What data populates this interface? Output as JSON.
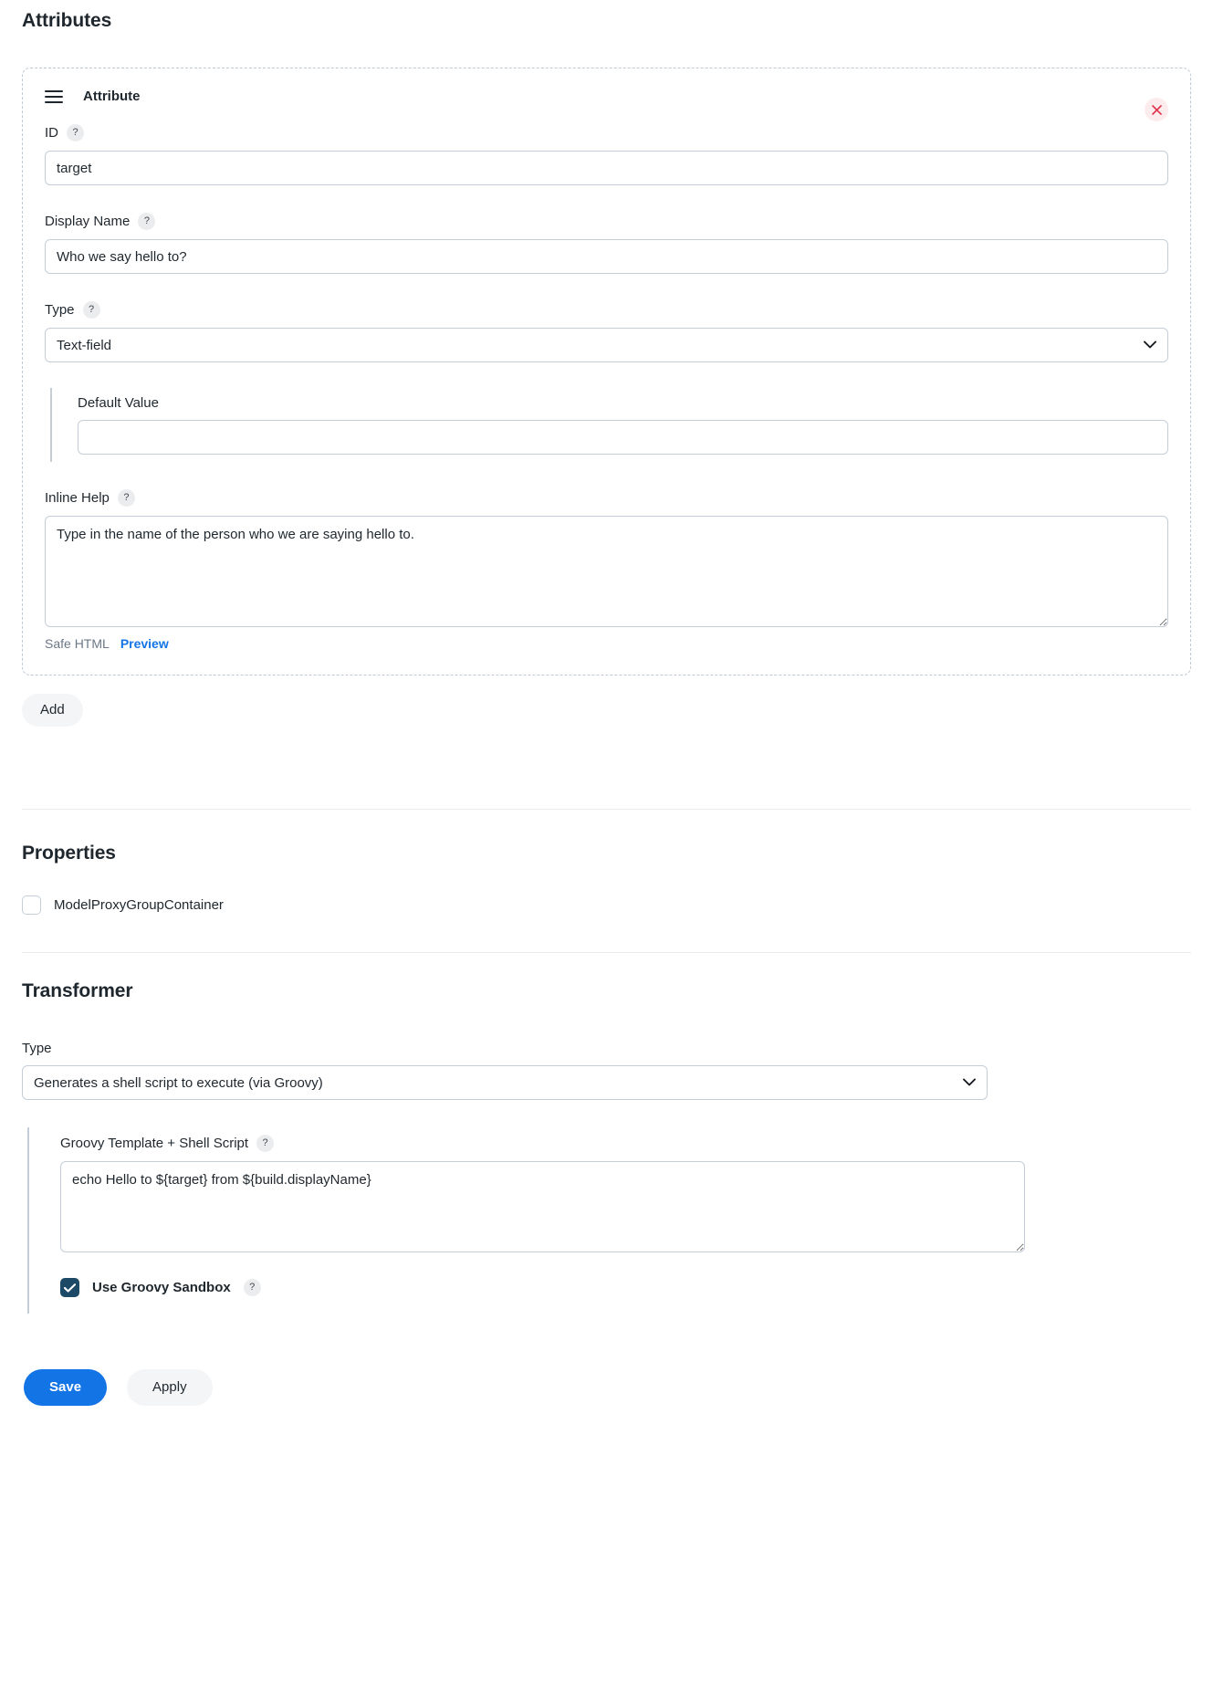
{
  "attributes_section": {
    "heading": "Attributes",
    "card": {
      "title": "Attribute",
      "drag_handle_icon": "drag-handle-icon",
      "remove_icon": "close-icon",
      "fields": {
        "id": {
          "label": "ID",
          "help": "?",
          "value": "target",
          "placeholder": ""
        },
        "display_name": {
          "label": "Display Name",
          "help": "?",
          "value": "Who we say hello to?",
          "placeholder": ""
        },
        "type": {
          "label": "Type",
          "help": "?",
          "value": "Text-field",
          "options": [
            "Text-field"
          ],
          "chevron_icon": "chevron-down-icon"
        },
        "default_value": {
          "label": "Default Value",
          "value": "",
          "placeholder": ""
        },
        "inline_help": {
          "label": "Inline Help",
          "help": "?",
          "value": "Type in the name of the person who we are saying hello to.",
          "placeholder": "",
          "safe_html_label": "Safe HTML",
          "preview_label": "Preview"
        }
      }
    },
    "add_label": "Add"
  },
  "properties_section": {
    "heading": "Properties",
    "items": [
      {
        "label": "ModelProxyGroupContainer",
        "checked": false
      }
    ]
  },
  "transformer_section": {
    "heading": "Transformer",
    "type": {
      "label": "Type",
      "value": "Generates a shell script to execute (via Groovy)",
      "options": [
        "Generates a shell script to execute (via Groovy)"
      ],
      "chevron_icon": "chevron-down-icon"
    },
    "script": {
      "label": "Groovy Template + Shell Script",
      "help": "?",
      "value": "echo Hello to ${target} from ${build.displayName}",
      "placeholder": ""
    },
    "sandbox": {
      "label": "Use Groovy Sandbox",
      "help": "?",
      "checked": true,
      "check_icon": "check-icon"
    }
  },
  "footer": {
    "save_label": "Save",
    "apply_label": "Apply"
  },
  "colors": {
    "accent_blue": "#1374e6",
    "link_blue": "#1374e6",
    "checkbox_checked": "#1c4966",
    "remove_bg": "#fdeced",
    "remove_fg": "#e0304a",
    "border": "#c4ced8",
    "dashed_border": "#bfc9d4"
  }
}
